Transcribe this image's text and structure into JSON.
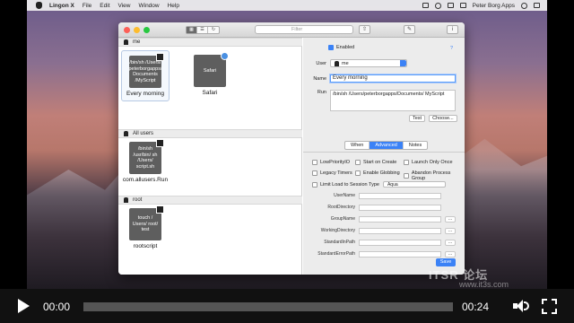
{
  "menubar": {
    "app": "Lingon X",
    "items": [
      "File",
      "Edit",
      "View",
      "Window",
      "Help"
    ],
    "right_user": "Peter Borg Apps"
  },
  "toolbar": {
    "search_placeholder": "Filter"
  },
  "groups": [
    {
      "header": "me",
      "items": [
        {
          "box": "/bin/sh /Users/ peterborgapps/ Documents /MyScript",
          "label": "Every morning",
          "selected": true
        },
        {
          "box": "Safari",
          "label": "Safari",
          "selected": false
        }
      ]
    },
    {
      "header": "All users",
      "items": [
        {
          "box": "/bin/sh /usr/bin/ sh /Users/ script.sh",
          "label": "com.allusers.Run",
          "selected": false
        }
      ]
    },
    {
      "header": "root",
      "items": [
        {
          "box": "touch / Users/ root/ test",
          "label": "rootscript",
          "selected": false
        }
      ]
    }
  ],
  "detail": {
    "enabled_label": "Enabled",
    "user_label": "User",
    "user_value": "me",
    "name_label": "Name",
    "name_value": "Every morning",
    "run_label": "Run",
    "run_value": "/bin/sh /Users/peterborgapps/Documents/ MyScript",
    "test_label": "Test",
    "choose_label": "Choose...",
    "tabs": [
      "When",
      "Advanced",
      "Notes"
    ],
    "active_tab": "Advanced",
    "checks": [
      "LowPriorityIO",
      "Start on Create",
      "Launch Only Once",
      "Legacy Timers",
      "Enable Globbing",
      "Abandon Process Group"
    ],
    "limit_label": "Limit Load to Session Type",
    "limit_value": "Aqua",
    "env_fields": [
      "UserName",
      "RootDirectory",
      "GroupName",
      "WorkingDirectory",
      "StandardInPath",
      "StandardErrorPath"
    ],
    "save_label": "Save"
  },
  "video": {
    "current_time": "00:00",
    "total_time": "00:24",
    "progress": 0
  },
  "watermark": {
    "line1": "ITSR 论坛",
    "line2": "www.it3s.com"
  }
}
